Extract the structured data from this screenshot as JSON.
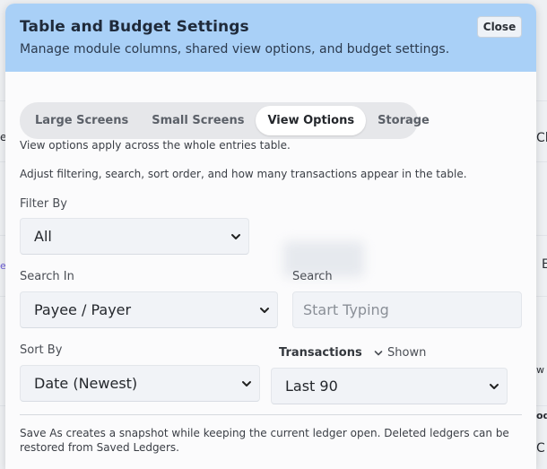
{
  "modal": {
    "title": "Table and Budget Settings",
    "subtitle": "Manage module columns, shared view options, and budget settings.",
    "close_label": "Close"
  },
  "tabs": [
    {
      "label": "Large Screens",
      "active": false
    },
    {
      "label": "Small Screens",
      "active": false
    },
    {
      "label": "View Options",
      "active": true
    },
    {
      "label": "Storage",
      "active": false
    }
  ],
  "view_options": {
    "intro": "View options apply across the whole entries table.",
    "description": "Adjust filtering, search, sort order, and how many transactions appear in the table.",
    "filter_by": {
      "label": "Filter By",
      "value": "All"
    },
    "search_in": {
      "label": "Search In",
      "value": "Payee / Payer"
    },
    "search": {
      "label": "Search",
      "placeholder": "Start Typing"
    },
    "sort_by": {
      "label": "Sort By",
      "value": "Date (Newest)"
    },
    "transactions": {
      "label": "Transactions",
      "toggle_label": "Shown",
      "value": "Last 90"
    },
    "footer": "Save As creates a snapshot while keeping the current ledger open. Deleted ledgers can be restored from Saved Ledgers."
  },
  "background": {
    "fragments": [
      "Cl",
      "E",
      "ed",
      "e",
      "w",
      "od",
      "C"
    ]
  },
  "colors": {
    "header_bg": "#a9d0f7",
    "modal_bg": "#fbfbfc",
    "tab_track": "#e6e7ea",
    "field_bg": "#f1f3f7"
  }
}
